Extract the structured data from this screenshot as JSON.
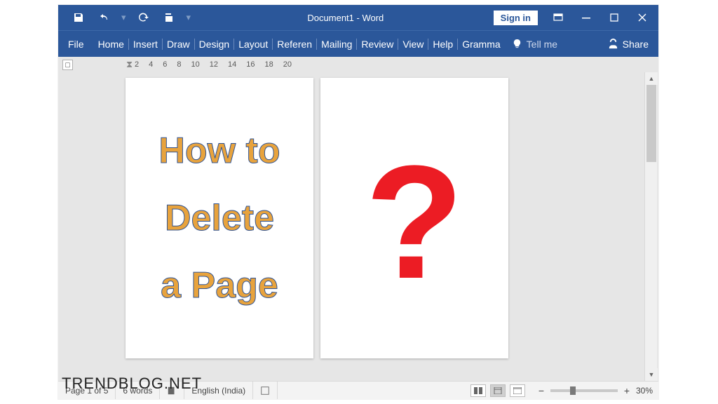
{
  "title": "Document1  -  Word",
  "signin": "Sign in",
  "file_tab": "File",
  "tabs": [
    "Home",
    "Insert",
    "Draw",
    "Design",
    "Layout",
    "Referen",
    "Mailing",
    "Review",
    "View",
    "Help",
    "Gramma"
  ],
  "tell_me": "Tell me",
  "share": "Share",
  "ruler_marks": [
    "2",
    "4",
    "6",
    "8",
    "10",
    "12",
    "14",
    "16",
    "18",
    "20"
  ],
  "page1": {
    "l1": "How to",
    "l2": "Delete",
    "l3": "a Page"
  },
  "page2_glyph": "?",
  "status": {
    "page": "Page 1 of 5",
    "words": "6 words",
    "lang": "English (India)",
    "zoom": "30%"
  },
  "watermark": "TRENDBLOG.NET"
}
